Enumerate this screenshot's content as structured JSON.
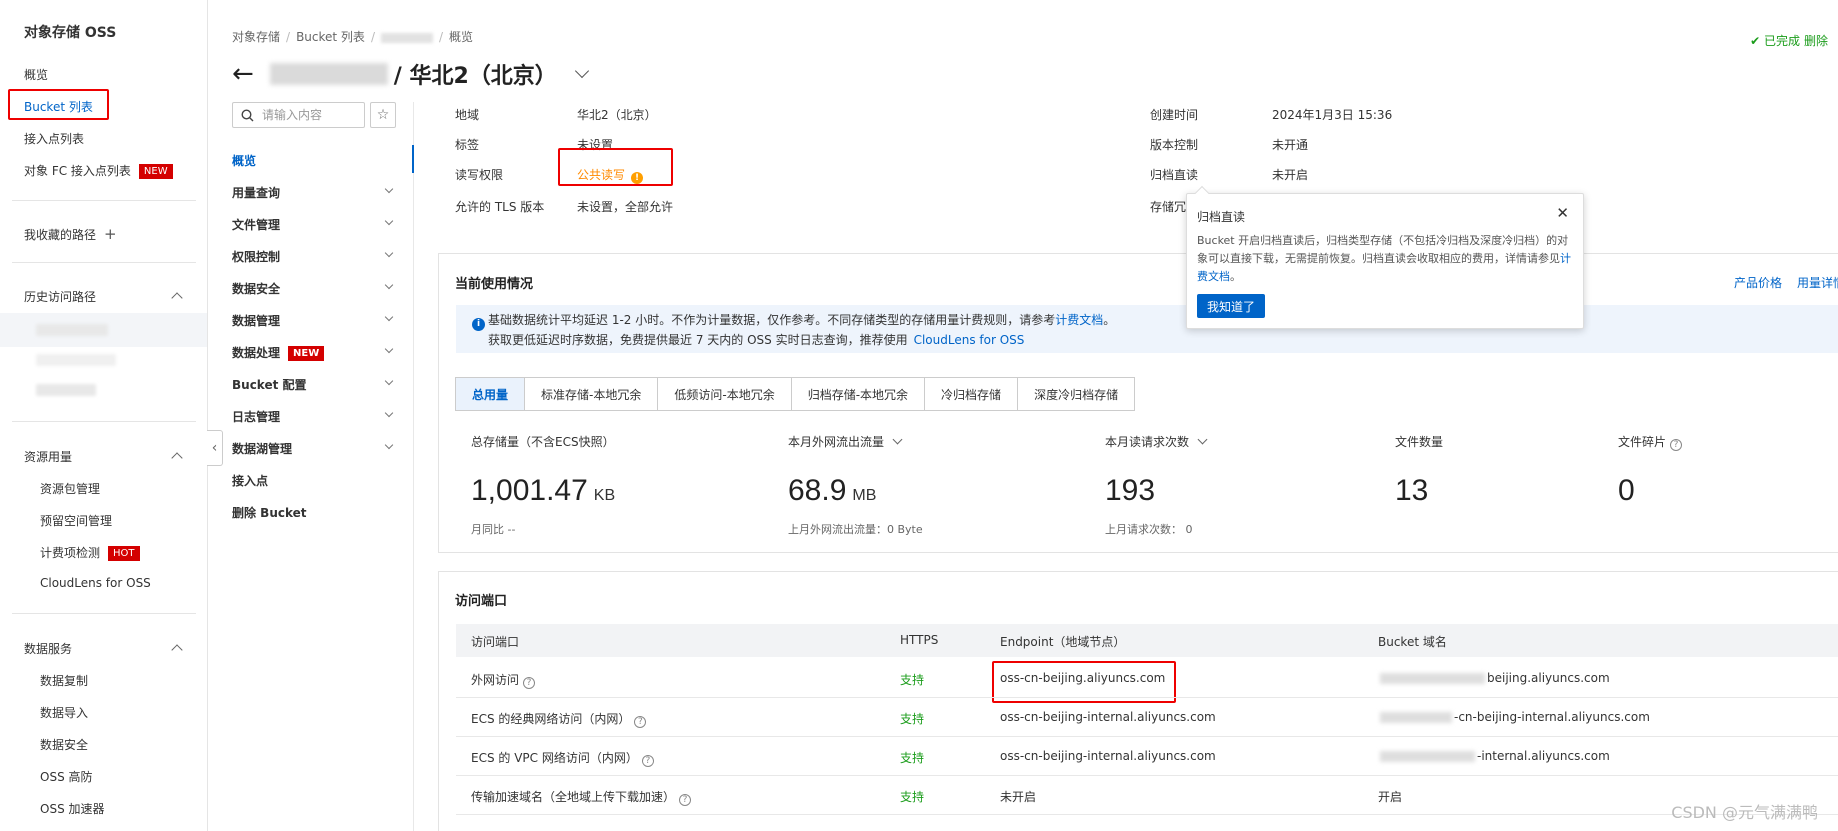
{
  "sidebar": {
    "title": "对象存储 OSS",
    "items": [
      {
        "label": "概览"
      },
      {
        "label": "Bucket 列表"
      },
      {
        "label": "接入点列表"
      },
      {
        "label": "对象 FC 接入点列表",
        "badge": "NEW"
      }
    ],
    "favorites_label": "我收藏的路径",
    "history_label": "历史访问路径",
    "resource_group": {
      "label": "资源用量",
      "items": [
        "资源包管理",
        "预留空间管理",
        "计费项检测",
        "CloudLens for OSS"
      ],
      "hot_badge": "HOT"
    },
    "data_group": {
      "label": "数据服务",
      "items": [
        "数据复制",
        "数据导入",
        "数据安全",
        "OSS 高防",
        "OSS 加速器"
      ]
    }
  },
  "header": {
    "breadcrumb": [
      "对象存储",
      "Bucket 列表",
      "概览"
    ],
    "title": "/ 华北2（北京）",
    "status_done": "已完成",
    "status_delete": "删除"
  },
  "inner_nav": {
    "search_placeholder": "请输入内容",
    "items": [
      {
        "label": "概览",
        "active": true,
        "chevron": false
      },
      {
        "label": "用量查询",
        "chevron": true
      },
      {
        "label": "文件管理",
        "chevron": true
      },
      {
        "label": "权限控制",
        "chevron": true
      },
      {
        "label": "数据安全",
        "chevron": true
      },
      {
        "label": "数据管理",
        "chevron": true
      },
      {
        "label": "数据处理",
        "chevron": true,
        "badge": "NEW"
      },
      {
        "label": "Bucket 配置",
        "chevron": true
      },
      {
        "label": "日志管理",
        "chevron": true
      },
      {
        "label": "数据湖管理",
        "chevron": true
      },
      {
        "label": "接入点",
        "chevron": false
      },
      {
        "label": "删除 Bucket",
        "chevron": false
      }
    ]
  },
  "basic_info": {
    "region_label": "地域",
    "region_value": "华北2（北京）",
    "tag_label": "标签",
    "tag_value": "未设置",
    "acl_label": "读写权限",
    "acl_value": "公共读写",
    "tls_label": "允许的 TLS 版本",
    "tls_value": "未设置，全部允许",
    "created_label": "创建时间",
    "created_value": "2024年1月3日 15:36",
    "version_label": "版本控制",
    "version_value": "未开通",
    "archive_label": "归档直读",
    "archive_value": "未开启",
    "storage_label": "存储冗"
  },
  "usage": {
    "title": "当前使用情况",
    "product_price": "产品价格",
    "usage_detail": "用量详情",
    "notice_line1": "基础数据统计平均延迟 1-2 小时。不作为计量数据，仅作参考。不同存储类型的存储用量计费规则，请参考",
    "notice_link": "计费文档",
    "notice_line1_end": "。",
    "notice_line2": "获取更低延迟时序数据，免费提供最近 7 天内的 OSS 实时日志查询，推荐使用",
    "notice_link2": "CloudLens for OSS",
    "tabs": [
      "总用量",
      "标准存储-本地冗余",
      "低频访问-本地冗余",
      "归档存储-本地冗余",
      "冷归档存储",
      "深度冷归档存储"
    ],
    "stats": [
      {
        "label": "总存储量（不含ECS快照）",
        "value": "1,001.47",
        "unit": "KB",
        "sub": "月同比 --"
      },
      {
        "label": "本月外网流出流量",
        "value": "68.9",
        "unit": "MB",
        "sub": "上月外网流出流量：0 Byte"
      },
      {
        "label": "本月读请求次数",
        "value": "193",
        "unit": "",
        "sub": "上月请求次数：  0"
      },
      {
        "label": "文件数量",
        "value": "13",
        "unit": "",
        "sub": ""
      },
      {
        "label": "文件碎片",
        "value": "0",
        "unit": "",
        "sub": ""
      }
    ]
  },
  "endpoints": {
    "title": "访问端口",
    "headers": [
      "访问端口",
      "HTTPS",
      "Endpoint（地域节点）",
      "Bucket 域名"
    ],
    "rows": [
      {
        "name": "外网访问",
        "https": "支持",
        "endpoint": "oss-cn-beijing.aliyuncs.com",
        "domain": "beijing.aliyuncs.com"
      },
      {
        "name": "ECS 的经典网络访问（内网）",
        "https": "支持",
        "endpoint": "oss-cn-beijing-internal.aliyuncs.com",
        "domain": "-cn-beijing-internal.aliyuncs.com"
      },
      {
        "name": "ECS 的 VPC 网络访问（内网）",
        "https": "支持",
        "endpoint": "oss-cn-beijing-internal.aliyuncs.com",
        "domain": "-internal.aliyuncs.com"
      },
      {
        "name": "传输加速域名（全地域上传下载加速）",
        "https": "支持",
        "endpoint": "未开启",
        "domain": "开启"
      }
    ]
  },
  "popover": {
    "title": "归档直读",
    "body": "Bucket 开启归档直读后，归档类型存储（不包括冷归档及深度冷归档）的对象可以直接下载，无需提前恢复。归档直读会收取相应的费用，详情请参见",
    "link": "计费文档",
    "body_end": "。",
    "button": "我知道了"
  },
  "watermark": "CSDN @元气满满鸭",
  "colors": {
    "accent": "#0064c8",
    "success": "#1a9c1a",
    "warning": "#ff8a00",
    "badge": "#d40000",
    "highlight": "#e00000"
  }
}
